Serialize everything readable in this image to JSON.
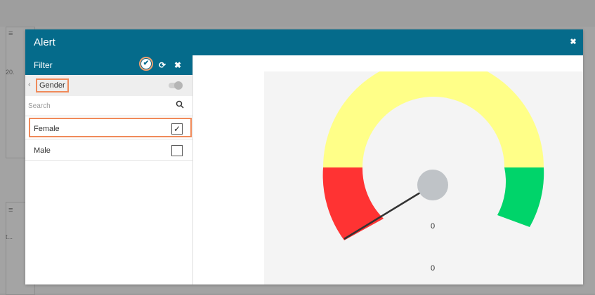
{
  "background": {
    "menu_glyph": "≡",
    "panel1_text": "20.",
    "panel2_text": "t..."
  },
  "modal": {
    "title": "Alert",
    "close_icon": "close-icon"
  },
  "filter": {
    "title": "Filter",
    "icons": [
      "check-icon",
      "refresh-icon",
      "clear-icon"
    ],
    "field": "Gender",
    "search_placeholder": "Search",
    "options": [
      {
        "label": "Female",
        "checked": true
      },
      {
        "label": "Male",
        "checked": false
      }
    ]
  },
  "gauge": {
    "bands": [
      {
        "color": "#ff3333",
        "label": "red"
      },
      {
        "color": "#ffff88",
        "label": "yellow"
      },
      {
        "color": "#00d46a",
        "label": "green"
      }
    ],
    "hub_color": "#bfc3c7",
    "needle_color": "#333333",
    "value": "0",
    "footer_value": "0"
  },
  "colors": {
    "header": "#056b8b",
    "highlight": "#f08a5a"
  }
}
